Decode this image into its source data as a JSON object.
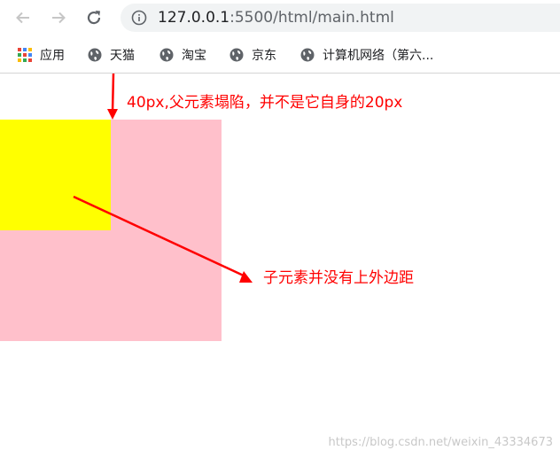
{
  "browser": {
    "url_host": "127.0.0.1",
    "url_rest": ":5500/html/main.html"
  },
  "bookmarks": [
    {
      "label": "应用",
      "icon": "apps-grid-icon"
    },
    {
      "label": "天猫",
      "icon": "globe-icon"
    },
    {
      "label": "淘宝",
      "icon": "globe-icon"
    },
    {
      "label": "京东",
      "icon": "globe-icon"
    },
    {
      "label": "计算机网络（第六...",
      "icon": "globe-icon"
    }
  ],
  "page": {
    "parent_color": "#ffc0cb",
    "child_color": "#ffff00",
    "annotation_color": "#ff0000",
    "annotation_top": "40px,父元素塌陷，并不是它自身的20px",
    "annotation_right": "子元素并没有上外边距",
    "watermark": "https://blog.csdn.net/weixin_43334673"
  }
}
